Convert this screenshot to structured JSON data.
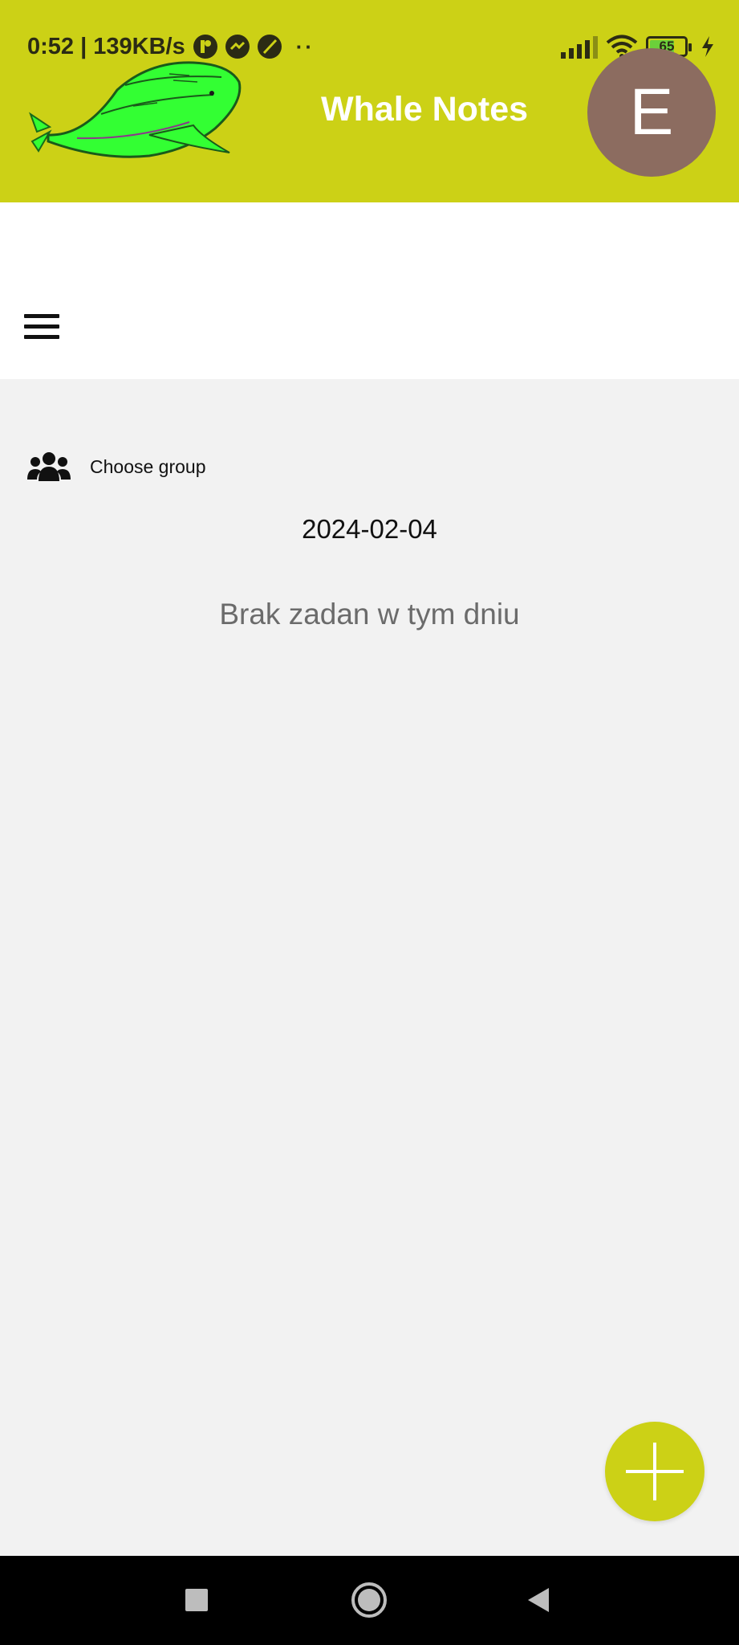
{
  "status_bar": {
    "time_speed": "0:52 | 139KB/s",
    "dots": "··",
    "battery_level": "65",
    "icons": [
      "app-notification-icon",
      "messenger-icon",
      "slash-circle-icon",
      "signal-icon",
      "wifi-icon",
      "battery-icon",
      "charging-icon"
    ]
  },
  "header": {
    "title": "Whale Notes",
    "avatar_letter": "E",
    "colors": {
      "header_bg": "#ccd116",
      "avatar_bg": "#8c6c60",
      "whale": "#33ff33"
    }
  },
  "toolbar": {
    "menu_icon": "hamburger-menu-icon"
  },
  "content": {
    "group_label": "Choose group",
    "group_icon": "users-group-icon",
    "date": "2024-02-04",
    "empty_message": "Brak zadan w tym dniu"
  },
  "fab": {
    "icon": "plus-icon",
    "color": "#ccd116"
  },
  "nav_bar": {
    "icons": [
      "recent-apps-icon",
      "home-icon",
      "back-icon"
    ]
  }
}
